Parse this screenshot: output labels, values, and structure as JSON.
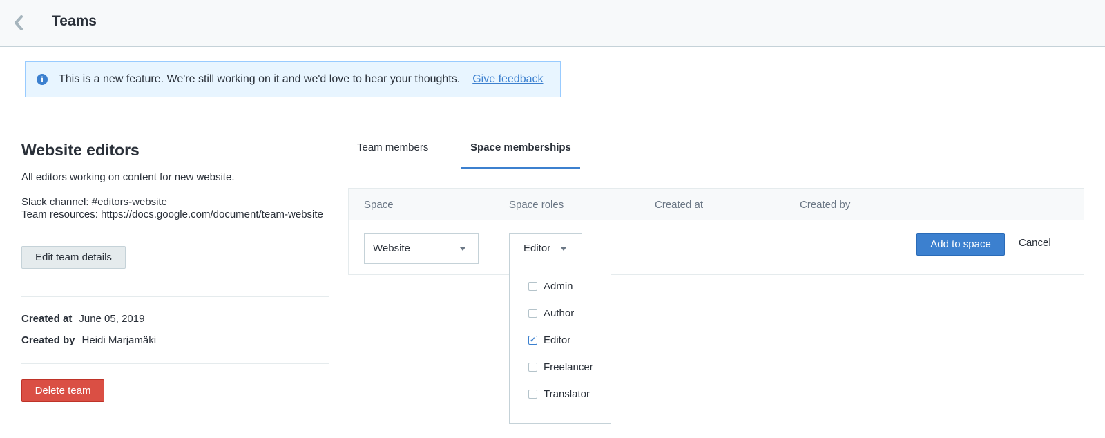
{
  "header": {
    "title": "Teams",
    "back_icon": "chevron-left-icon"
  },
  "notice": {
    "text": "This is a new feature. We're still working on it and we'd love to hear your thoughts.",
    "link": "Give feedback",
    "icon": "info-icon"
  },
  "team": {
    "name": "Website editors",
    "description": "All editors working on content for new website.",
    "slack": "Slack channel: #editors-website",
    "resources": "Team resources: https://docs.google.com/document/team-website",
    "edit_label": "Edit team details",
    "created_at_label": "Created at",
    "created_at": "June 05, 2019",
    "created_by_label": "Created by",
    "created_by": "Heidi Marjamäki",
    "delete_label": "Delete team"
  },
  "tabs": [
    {
      "label": "Team members",
      "active": false
    },
    {
      "label": "Space memberships",
      "active": true
    }
  ],
  "table": {
    "headers": [
      "Space",
      "Space roles",
      "Created at",
      "Created by"
    ],
    "space_select": "Website",
    "role_select": "Editor",
    "add_label": "Add to space",
    "cancel_label": "Cancel"
  },
  "roles": [
    {
      "label": "Admin",
      "checked": false
    },
    {
      "label": "Author",
      "checked": false
    },
    {
      "label": "Editor",
      "checked": true
    },
    {
      "label": "Freelancer",
      "checked": false
    },
    {
      "label": "Translator",
      "checked": false
    }
  ],
  "colors": {
    "accent": "#3c80cf",
    "danger": "#da4f44",
    "notice_bg": "#e8f5ff"
  }
}
